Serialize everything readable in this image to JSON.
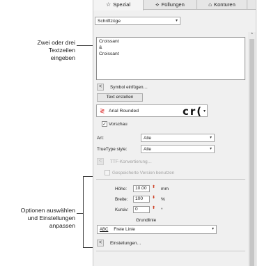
{
  "callouts": {
    "top": [
      "Zwei oder drei",
      "Textzeilen",
      "eingeben"
    ],
    "bottom": [
      "Optionen auswählen",
      "und Einstellungen",
      "anpassen"
    ]
  },
  "tabs": [
    {
      "label": "Spezial",
      "icon": "☆"
    },
    {
      "label": "Füllungen",
      "icon": "⟡"
    },
    {
      "label": "Konturen",
      "icon": "⌂"
    }
  ],
  "style_select": {
    "value": "Schriftzüge"
  },
  "text_lines": [
    "Croissant",
    "&",
    "Croissant"
  ],
  "symbol_insert_label": "Symbol einfügen…",
  "create_text_label": "Text erstellen",
  "font": {
    "name": "Arial Rounded",
    "preview": "cr("
  },
  "preview_label": "Vorschau",
  "preview_checked": "✓",
  "type": {
    "label": "Art:",
    "value": "Alle"
  },
  "truetype": {
    "label": "TrueType style:",
    "value": "Alle"
  },
  "ttf_label": "TTF-Konvertierung…",
  "saved_version_label": "Gespeicherte Version benutzen",
  "height": {
    "label": "Höhe:",
    "value": "10.00",
    "unit": "mm"
  },
  "width": {
    "label": "Breite:",
    "value": "100",
    "unit": "%"
  },
  "italic": {
    "label": "Kursiv:",
    "value": "0",
    "unit": "°"
  },
  "baseline": {
    "title": "Grundlinie",
    "icon_text": "ABC",
    "value": "Freie Linie"
  },
  "settings_label": "Einstellungen…",
  "arrow_left": "<",
  "dropdown_arrow": "▾",
  "spin_glyph": "⬍",
  "scroll_up": "^",
  "colors": {
    "panel_bg": "#f0f0f0",
    "spin_accent": "#cc3b1f",
    "font_icon": "#dd3333"
  }
}
